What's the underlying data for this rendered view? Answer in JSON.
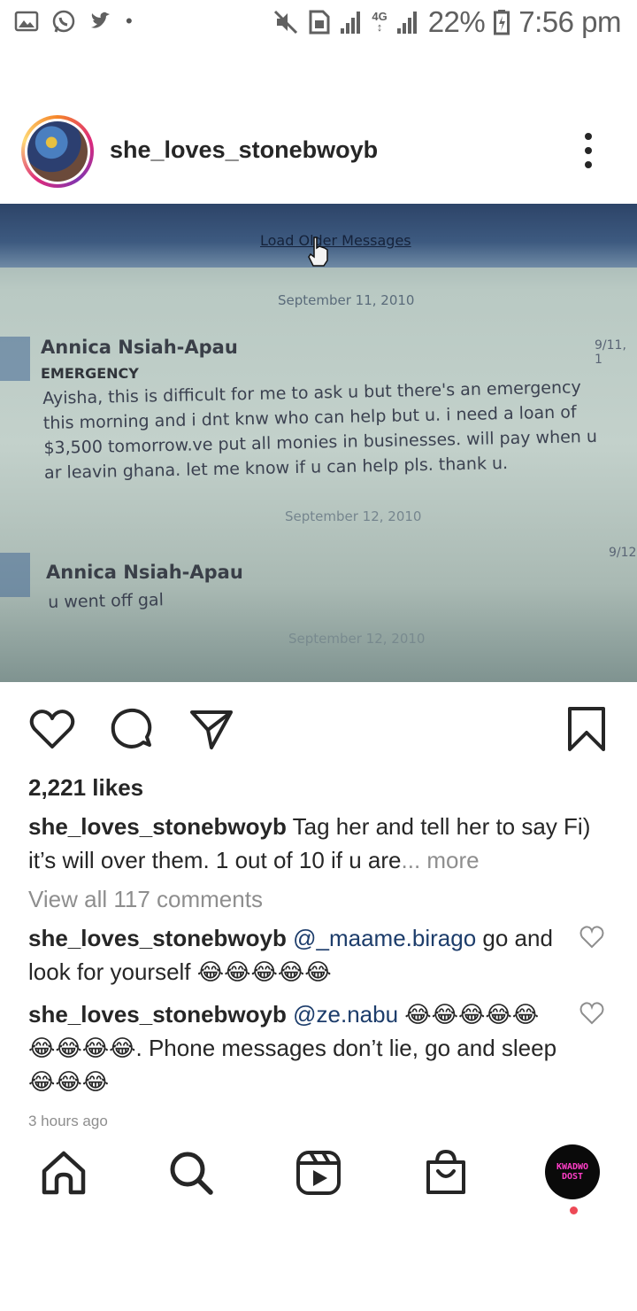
{
  "status_bar": {
    "battery": "22%",
    "time": "7:56 pm",
    "network": "4G",
    "left_icons": [
      "gallery-icon",
      "whatsapp-icon",
      "twitter-icon"
    ],
    "right_icons": [
      "mute-icon",
      "sim-icon",
      "signal-icon",
      "battery-icon"
    ]
  },
  "post": {
    "username": "she_loves_stonebwoyb",
    "photo": {
      "load_older": "Load Older Messages",
      "date1": "September 11, 2010",
      "sender1": "Annica Nsiah-Apau",
      "subject1": "EMERGENCY",
      "time1": "9/11, 1",
      "message1_lines": [
        "Ayisha, this is difficult for me to ask u but there's an emergency",
        "this morning and i dnt knw who can help but u. i need a loan of",
        "$3,500 tomorrow.ve put all monies in businesses. will pay when u",
        "ar leavin ghana. let me know if u can help pls. thank u."
      ],
      "date2": "September 12, 2010",
      "time2": "9/12",
      "sender2": "Annica Nsiah-Apau",
      "message2": "u went off gal",
      "date3": "September 12, 2010"
    },
    "likes": "2,221 likes",
    "caption_user": "she_loves_stonebwoyb",
    "caption_text": " Tag her and tell her to say Fi) it’s will over them. 1 out of 10 if u are",
    "caption_more": "... more",
    "view_all": "View all 117 comments",
    "comments": [
      {
        "user": "she_loves_stonebwoyb",
        "mention": "@_maame.birago",
        "text": " go and look for yourself 😂😂😂😂😂"
      },
      {
        "user": "she_loves_stonebwoyb",
        "mention": "@ze.nabu",
        "text": " 😂😂😂😂😂😂😂😂😂. Phone messages don’t lie, go and sleep 😂😂😂"
      }
    ],
    "time_ago": "3 hours ago"
  },
  "bottom_nav": {
    "items": [
      "home-icon",
      "search-icon",
      "reels-icon",
      "shop-icon",
      "profile-avatar"
    ],
    "profile_line1": "KWADWO",
    "profile_line2": "DOST"
  },
  "colors": {
    "text": "#262626",
    "muted": "#8e8e8e",
    "mention": "#1d3d6b",
    "notification": "#ed4956"
  }
}
